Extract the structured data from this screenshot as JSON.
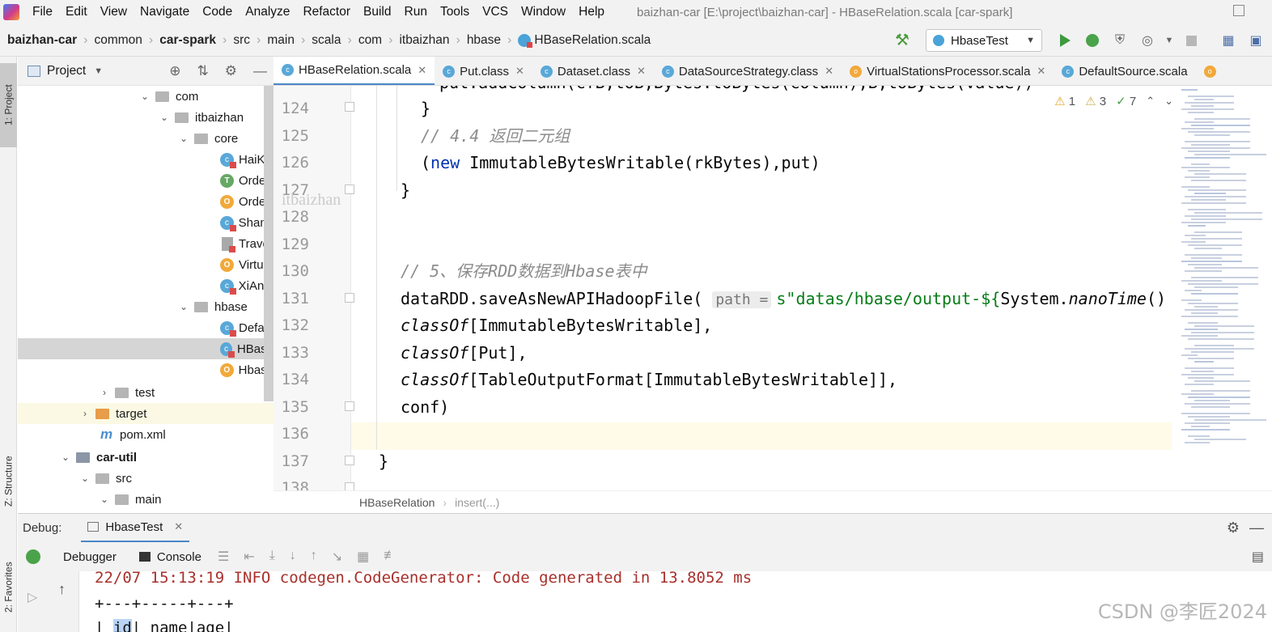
{
  "menubar": {
    "items": [
      "File",
      "Edit",
      "View",
      "Navigate",
      "Code",
      "Analyze",
      "Refactor",
      "Build",
      "Run",
      "Tools",
      "VCS",
      "Window",
      "Help"
    ],
    "window_title": "baizhan-car [E:\\project\\baizhan-car] - HBaseRelation.scala [car-spark]"
  },
  "navbar": {
    "crumbs": [
      "baizhan-car",
      "common",
      "car-spark",
      "src",
      "main",
      "scala",
      "com",
      "itbaizhan",
      "hbase",
      "HBaseRelation.scala"
    ],
    "run_config": "HbaseTest"
  },
  "left_strip": {
    "project_tab": "1: Project",
    "structure_tab": "Z: Structure",
    "favorites_tab": "2: Favorites"
  },
  "project_panel": {
    "title": "Project",
    "tree": [
      {
        "label": "com",
        "icon": "folder",
        "arrow": "open"
      },
      {
        "label": "itbaizhan",
        "icon": "folder",
        "arrow": "open"
      },
      {
        "label": "core",
        "icon": "folder",
        "arrow": "open"
      },
      {
        "label": "HaiKo",
        "icon": "scala-class"
      },
      {
        "label": "OrderI",
        "icon": "scala-trait"
      },
      {
        "label": "OrderI",
        "icon": "scala-object"
      },
      {
        "label": "Shang",
        "icon": "scala-class"
      },
      {
        "label": "Travel",
        "icon": "scala-file"
      },
      {
        "label": "Virtua",
        "icon": "scala-object"
      },
      {
        "label": "XiAnO",
        "icon": "scala-class"
      },
      {
        "label": "hbase",
        "icon": "folder",
        "arrow": "open"
      },
      {
        "label": "Defau",
        "icon": "scala-class"
      },
      {
        "label": "HBase",
        "icon": "scala-class",
        "selected": true
      },
      {
        "label": "Hbase",
        "icon": "scala-object"
      },
      {
        "label": "test",
        "icon": "folder",
        "arrow": "closed"
      },
      {
        "label": "target",
        "icon": "folder-excluded",
        "arrow": "closed"
      },
      {
        "label": "pom.xml",
        "icon": "maven-file"
      },
      {
        "label": "car-util",
        "icon": "module-folder",
        "arrow": "open",
        "bold": true
      },
      {
        "label": "src",
        "icon": "folder",
        "arrow": "open"
      },
      {
        "label": "main",
        "icon": "folder",
        "arrow": "open"
      }
    ]
  },
  "editor_tabs": [
    {
      "label": "HBaseRelation.scala",
      "icon": "c",
      "active": true
    },
    {
      "label": "Put.class",
      "icon": "c"
    },
    {
      "label": "Dataset.class",
      "icon": "c"
    },
    {
      "label": "DataSourceStrategy.class",
      "icon": "c"
    },
    {
      "label": "VirtualStationsProcessor.scala",
      "icon": "o"
    },
    {
      "label": "DefaultSource.scala",
      "icon": "c"
    }
  ],
  "editor": {
    "line_numbers": [
      "124",
      "125",
      "126",
      "127",
      "128",
      "129",
      "130",
      "131",
      "132",
      "133",
      "134",
      "135",
      "136",
      "137",
      "138"
    ],
    "partial_top_line": "put.addColumn(cfB,toB,Bytes.toBytes(column),B,toBytes(value))",
    "watermark": "itbaizhan",
    "inspections": {
      "warnings": "1",
      "weak_warnings": "3",
      "typos": "7"
    },
    "code": {
      "l124": "}",
      "l125_comment": "// 4.4 返回二元组",
      "l126_open": "(",
      "l126_kw": "new",
      "l126_rest": " ImmutableBytesWritable(rkBytes),put)",
      "l127": "}",
      "l130_comment": "// 5、保存RDD数据到Hbase表中",
      "l131_pre": "dataRDD.saveAsNewAPIHadoopFile(",
      "l131_hint": "path =",
      "l131_str": "s\"datas/hbase/output-${",
      "l131_obj": "System.",
      "l131_method": "nanoTime",
      "l131_tail": "()",
      "l132_kw": "classOf",
      "l132_rest": "[ImmutableBytesWritable],",
      "l133_kw": "classOf",
      "l133_rest": "[Put],",
      "l134_kw": "classOf",
      "l134_rest": "[TableOutputFormat[ImmutableBytesWritable]],",
      "l135": "conf)",
      "l137": "}"
    },
    "breadcrumb": [
      "HBaseRelation",
      "insert(...)"
    ]
  },
  "debug": {
    "label": "Debug:",
    "session_tab": "HbaseTest",
    "debugger_tab": "Debugger",
    "console_tab": "Console",
    "console_lines": {
      "log": "22/07 15:13:19 INFO codegen.CodeGenerator: Code generated in 13.8052 ms",
      "border": "+---+-----+---+",
      "header_pre": "| ",
      "header_id": "id",
      "header_post": "| name|age|"
    }
  },
  "watermark": "CSDN @李匠2024"
}
